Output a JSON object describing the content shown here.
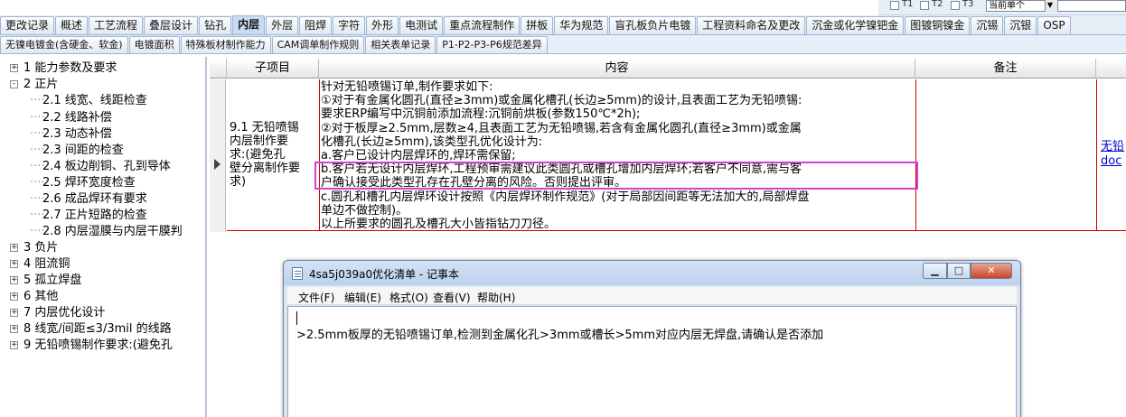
{
  "top_controls": {
    "checks": [
      {
        "label": "T1"
      },
      {
        "label": "T2"
      },
      {
        "label": "T3"
      }
    ],
    "select_value": "当前单个"
  },
  "tabs_row1": [
    {
      "label": "更改记录",
      "active": false
    },
    {
      "label": "概述",
      "active": false
    },
    {
      "label": "工艺流程",
      "active": false
    },
    {
      "label": "叠层设计",
      "active": false
    },
    {
      "label": "钻孔",
      "active": false
    },
    {
      "label": "内层",
      "active": true
    },
    {
      "label": "外层",
      "active": false
    },
    {
      "label": "阻焊",
      "active": false
    },
    {
      "label": "字符",
      "active": false
    },
    {
      "label": "外形",
      "active": false
    },
    {
      "label": "电测试",
      "active": false
    },
    {
      "label": "重点流程制作",
      "active": false
    },
    {
      "label": "拼板",
      "active": false
    },
    {
      "label": "华为规范",
      "active": false
    },
    {
      "label": "盲孔板负片电镀",
      "active": false
    },
    {
      "label": "工程资料命名及更改",
      "active": false
    },
    {
      "label": "沉金或化学镍钯金",
      "active": false
    },
    {
      "label": "图镀铜镍金",
      "active": false
    },
    {
      "label": "沉锡",
      "active": false
    },
    {
      "label": "沉银",
      "active": false
    },
    {
      "label": "OSP",
      "active": false
    }
  ],
  "tabs_row2": [
    {
      "label": "无镍电镀金(含硬金、软金)"
    },
    {
      "label": "电镀面积"
    },
    {
      "label": "特殊板材制作能力"
    },
    {
      "label": "CAM调单制作规则"
    },
    {
      "label": "相关表单记录"
    },
    {
      "label": "P1-P2-P3-P6规范差异"
    }
  ],
  "tree": [
    {
      "label": "1 能力参数及要求",
      "level": 0,
      "expander": "+"
    },
    {
      "label": "2 正片",
      "level": 0,
      "expander": "-"
    },
    {
      "label": "2.1 线宽、线距检查",
      "level": 1
    },
    {
      "label": "2.2 线路补偿",
      "level": 1
    },
    {
      "label": "2.3 动态补偿",
      "level": 1
    },
    {
      "label": "2.3 间距的检查",
      "level": 1
    },
    {
      "label": "2.4 板边削铜、孔到导体",
      "level": 1
    },
    {
      "label": "2.5 焊环宽度检查",
      "level": 1
    },
    {
      "label": "2.6 成品焊环有要求",
      "level": 1
    },
    {
      "label": "2.7 正片短路的检查",
      "level": 1
    },
    {
      "label": "2.8 内层湿膜与内层干膜判",
      "level": 1
    },
    {
      "label": "3 负片",
      "level": 0,
      "expander": "+"
    },
    {
      "label": "4 阻流铜",
      "level": 0,
      "expander": "+"
    },
    {
      "label": "5 孤立焊盘",
      "level": 0,
      "expander": "+"
    },
    {
      "label": "6 其他",
      "level": 0,
      "expander": "+"
    },
    {
      "label": "7 内层优化设计",
      "level": 0,
      "expander": "+"
    },
    {
      "label": "8 线宽/间距≤3/3mil 的线路",
      "level": 0,
      "expander": "+"
    },
    {
      "label": "9 无铅喷锡制作要求:(避免孔",
      "level": 0,
      "expander": "+"
    }
  ],
  "grid": {
    "headers": {
      "sub": "子项目",
      "content": "内容",
      "remark": "备注"
    },
    "row": {
      "sub_lines": [
        "9.1 无铅喷锡",
        "内层制作要",
        "求:(避免孔",
        "壁分离制作要",
        "求)"
      ],
      "content_lines": [
        "针对无铅喷锡订单,制作要求如下:",
        "①对于有金属化圆孔(直径≥3mm)或金属化槽孔(长边≥5mm)的设计,且表面工艺为无铅喷锡:",
        "要求ERP编写中沉铜前添加流程:沉铜前烘板(参数150℃*2h);",
        "②对于板厚≥2.5mm,层数≥4,且表面工艺为无铅喷锡,若含有金属化圆孔(直径≥3mm)或金属",
        "化槽孔(长边≥5mm),该类型孔优化设计为:",
        "a.客户已设计内层焊环的,焊环需保留;",
        "b.客户若无设计内层焊环,工程预审需建议此类圆孔或槽孔增加内层焊环;若客户不同意,需与客",
        "户确认接受此类型孔存在孔壁分离的风险。否则提出评审。",
        "c.圆孔和槽孔内层焊环设计按照《内层焊环制作规范》(对于局部因间距等无法加大的,局部焊盘",
        "单边不做控制)。",
        "以上所要求的圆孔及槽孔大小皆指钻刀刀径。"
      ],
      "remark": "",
      "link_lines": [
        "无铅",
        "doc"
      ]
    }
  },
  "notepad": {
    "title": "4sa5j039a0优化清单 - 记事本",
    "buttons": {
      "minimize": "▁",
      "maximize": "□",
      "close": "✕"
    },
    "menu": [
      "文件(F)",
      "编辑(E)",
      "格式(O)",
      "查看(V)",
      "帮助(H)"
    ],
    "text": ">2.5mm板厚的无铅喷锡订单,检测到金属化孔>3mm或槽长>5mm对应内层无焊盘,请确认是否添加"
  }
}
